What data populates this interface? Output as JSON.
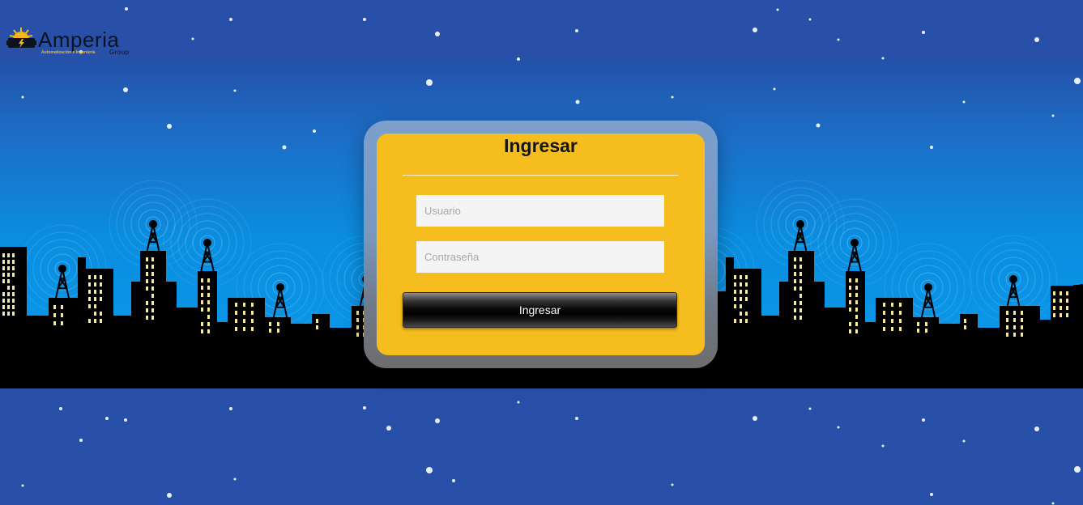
{
  "brand": {
    "name": "Amperia",
    "tagline": "Automatización e Ingeniería",
    "group": "Group"
  },
  "login": {
    "title": "Ingresar",
    "username_placeholder": "Usuario",
    "password_placeholder": "Contraseña",
    "submit_label": "Ingresar"
  },
  "colors": {
    "sky": "#2950a8",
    "card": "#f5bd1d",
    "skyline": "#000000",
    "window_light": "#f6eaa0"
  },
  "icons": {
    "logo": "sun-battery-icon"
  }
}
